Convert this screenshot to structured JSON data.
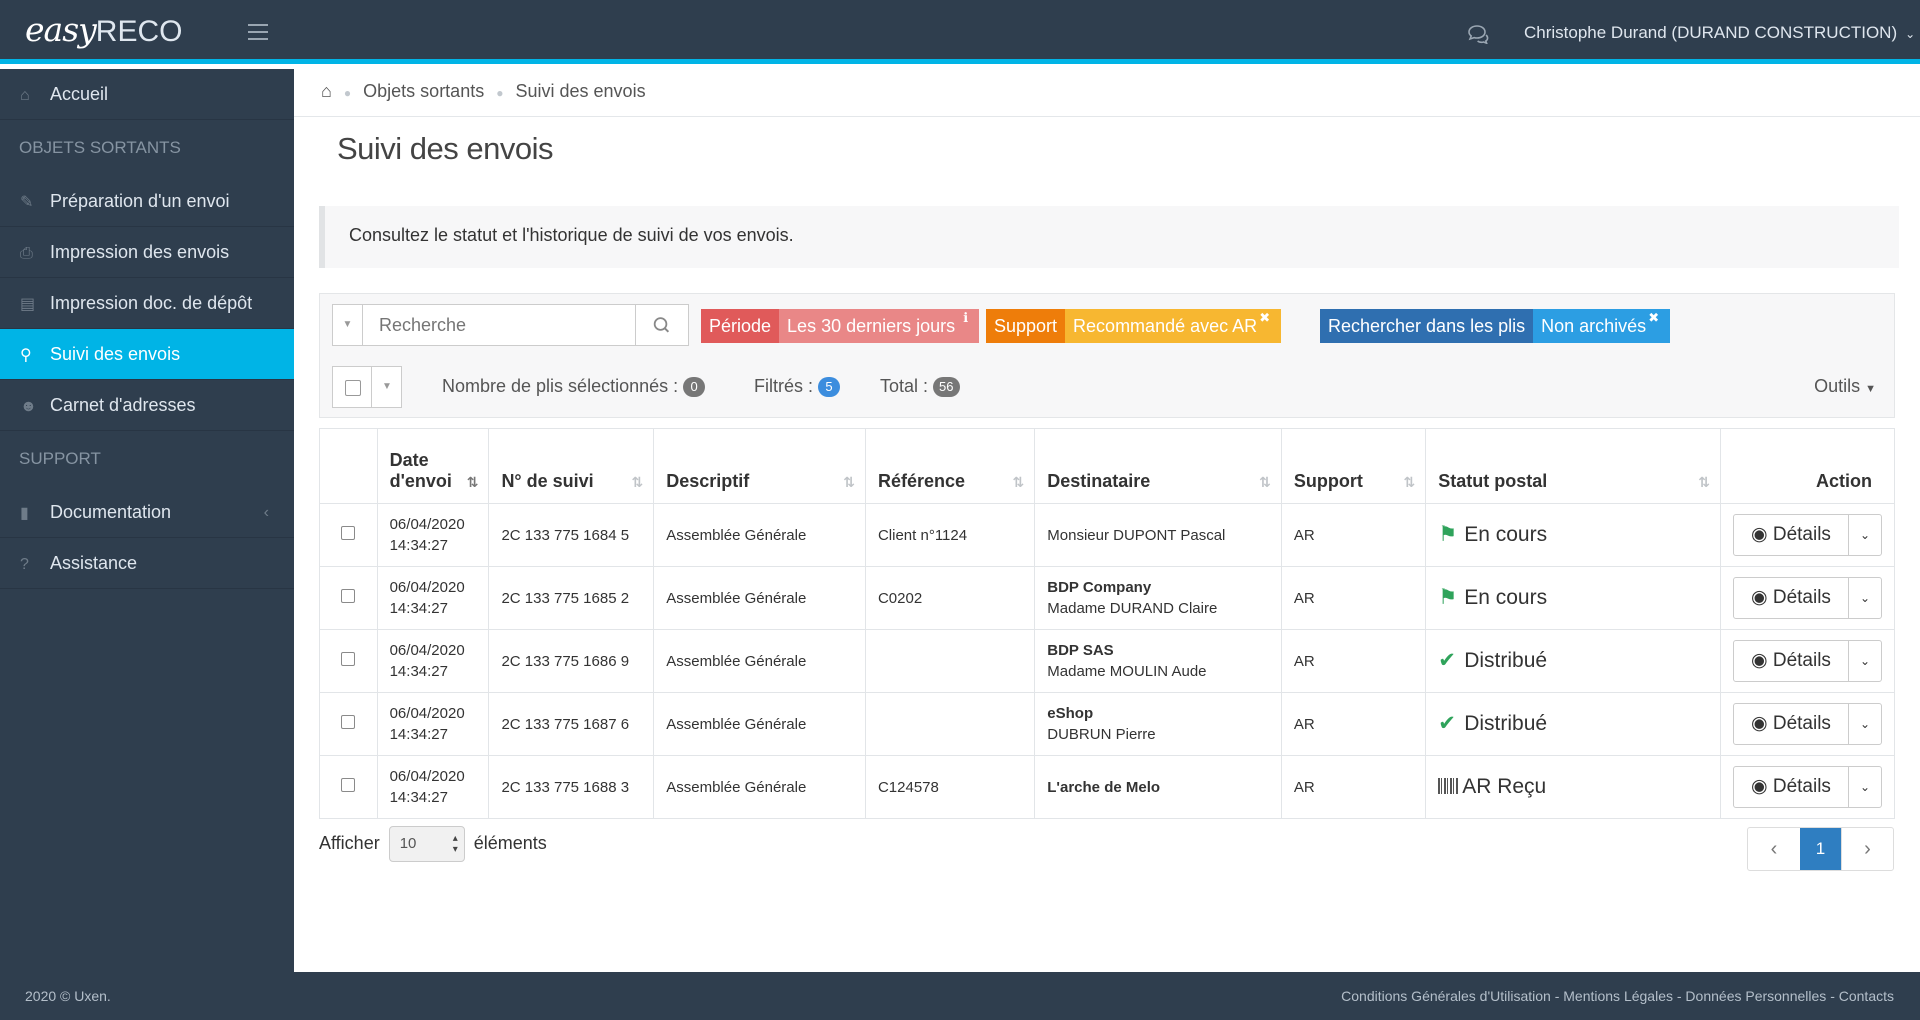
{
  "header": {
    "logo_easy": "easy",
    "logo_reco": "RECO",
    "user": "Christophe Durand (DURAND CONSTRUCTION)"
  },
  "sidebar": {
    "home": "Accueil",
    "section_outgoing": "OBJETS SORTANTS",
    "items": [
      {
        "label": "Préparation d'un envoi",
        "icon": "pencil-icon"
      },
      {
        "label": "Impression des envois",
        "icon": "printer-icon"
      },
      {
        "label": "Impression doc. de dépôt",
        "icon": "document-icon"
      },
      {
        "label": "Suivi des envois",
        "icon": "search-icon"
      },
      {
        "label": "Carnet d'adresses",
        "icon": "users-icon"
      }
    ],
    "section_support": "SUPPORT",
    "support_items": [
      {
        "label": "Documentation",
        "icon": "book-icon"
      },
      {
        "label": "Assistance",
        "icon": "question-icon"
      }
    ],
    "accent": "#00b4e6"
  },
  "breadcrumb": {
    "level1": "Objets sortants",
    "level2": "Suivi des envois"
  },
  "page": {
    "title": "Suivi des envois",
    "info": "Consultez le statut et l'historique de suivi de vos envois."
  },
  "filters": {
    "search_placeholder": "Recherche",
    "tags": [
      {
        "key": "Période",
        "value": "Les 30 derniers jours",
        "mark": "ℹ"
      },
      {
        "key": "Support",
        "value": "Recommandé avec AR",
        "mark": "✖"
      },
      {
        "key": "Rechercher dans les plis",
        "value": "Non archivés",
        "mark": "✖"
      }
    ],
    "selected_label": "Nombre de plis sélectionnés :",
    "selected_count": "0",
    "filtered_label": "Filtrés :",
    "filtered_count": "5",
    "total_label": "Total :",
    "total_count": "56",
    "tools": "Outils"
  },
  "table": {
    "headers": {
      "date_l1": "Date",
      "date_l2": "d'envoi",
      "tracking": "N° de suivi",
      "description": "Descriptif",
      "reference": "Référence",
      "recipient": "Destinataire",
      "support": "Support",
      "status": "Statut postal",
      "action": "Action"
    },
    "action_label": "Détails",
    "rows": [
      {
        "date": "06/04/2020",
        "time": "14:34:27",
        "tracking": "2C 133 775 1684 5",
        "description": "Assemblée Générale",
        "reference": "Client n°1124",
        "company": "",
        "person": "Monsieur DUPONT Pascal",
        "support": "AR",
        "status": "En cours",
        "status_icon": "flag-icon"
      },
      {
        "date": "06/04/2020",
        "time": "14:34:27",
        "tracking": "2C 133 775 1685 2",
        "description": "Assemblée Générale",
        "reference": "C0202",
        "company": "BDP Company",
        "person": "Madame DURAND Claire",
        "support": "AR",
        "status": "En cours",
        "status_icon": "flag-icon"
      },
      {
        "date": "06/04/2020",
        "time": "14:34:27",
        "tracking": "2C 133 775 1686 9",
        "description": "Assemblée Générale",
        "reference": "",
        "company": "BDP SAS",
        "person": "Madame MOULIN Aude",
        "support": "AR",
        "status": "Distribué",
        "status_icon": "check-icon"
      },
      {
        "date": "06/04/2020",
        "time": "14:34:27",
        "tracking": "2C 133 775 1687 6",
        "description": "Assemblée Générale",
        "reference": "",
        "company": "eShop",
        "person": "DUBRUN Pierre",
        "support": "AR",
        "status": "Distribué",
        "status_icon": "check-icon"
      },
      {
        "date": "06/04/2020",
        "time": "14:34:27",
        "tracking": "2C 133 775 1688 3",
        "description": "Assemblée Générale",
        "reference": "C124578",
        "company": "L'arche de Melo",
        "person": "",
        "support": "AR",
        "status": "AR Reçu",
        "status_icon": "barcode-icon"
      }
    ]
  },
  "pagination": {
    "show_label": "Afficher",
    "page_size": "10",
    "elements_label": "éléments",
    "current_page": "1"
  },
  "footer": {
    "copyright": "2020 © Uxen.",
    "links": "Conditions Générales d'Utilisation - Mentions Légales - Données Personnelles - Contacts"
  }
}
